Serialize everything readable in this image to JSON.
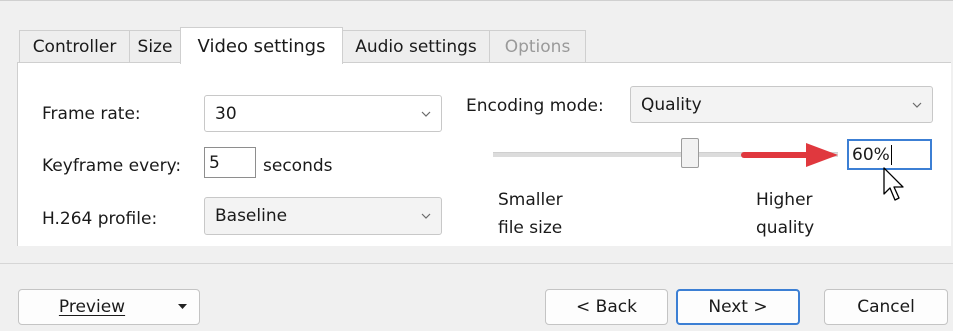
{
  "tabs": [
    {
      "label": "Controller",
      "state": "normal"
    },
    {
      "label": "Size",
      "state": "normal"
    },
    {
      "label": "Video settings",
      "state": "active"
    },
    {
      "label": "Audio settings",
      "state": "normal"
    },
    {
      "label": "Options",
      "state": "disabled"
    }
  ],
  "video": {
    "frame_rate_label": "Frame rate:",
    "frame_rate_value": "30",
    "keyframe_label": "Keyframe every:",
    "keyframe_value": "5",
    "keyframe_unit": "seconds",
    "profile_label": "H.264 profile:",
    "profile_value": "Baseline",
    "encoding_mode_label": "Encoding mode:",
    "encoding_mode_value": "Quality",
    "quality_value": "60%",
    "quality_fraction": 0.6,
    "smaller_label_1": "Smaller",
    "smaller_label_2": "file size",
    "higher_label_1": "Higher",
    "higher_label_2": "quality"
  },
  "footer": {
    "preview_label": "Preview",
    "back_label": "< Back",
    "next_label": "Next >",
    "cancel_label": "Cancel"
  },
  "colors": {
    "accent": "#3c7fd4",
    "annotation_arrow": "#e0383e"
  },
  "icons": {
    "dropdown": "chevron-down-icon",
    "preview_menu": "caret-down-icon",
    "cursor": "mouse-pointer-icon",
    "annotation": "red-arrow-icon"
  }
}
